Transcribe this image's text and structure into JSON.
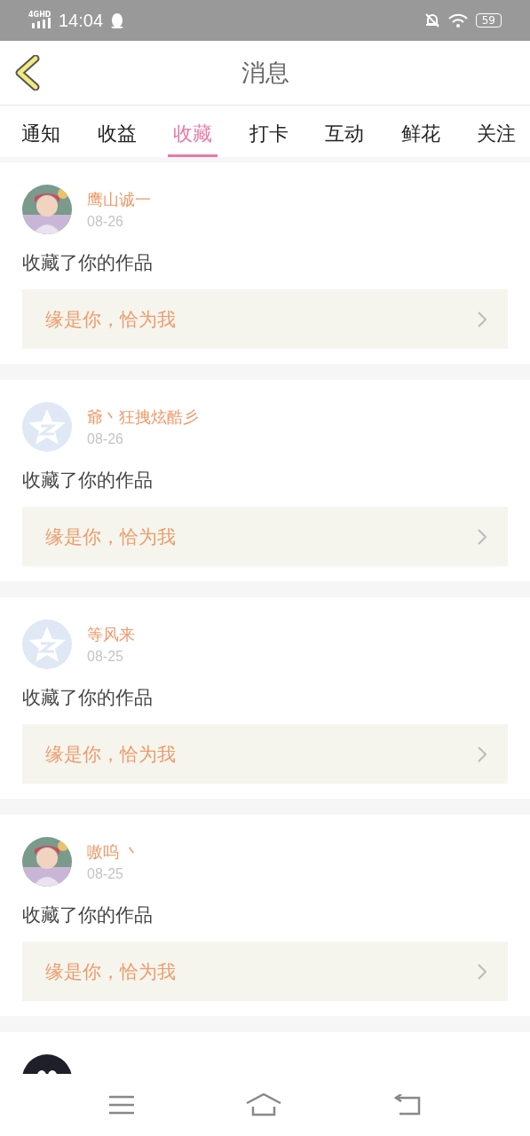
{
  "status_bar": {
    "network": "4GHD",
    "time": "14:04",
    "battery": "59"
  },
  "header": {
    "title": "消息"
  },
  "tabs": [
    {
      "label": "通知",
      "selected": false
    },
    {
      "label": "收益",
      "selected": false
    },
    {
      "label": "收藏",
      "selected": true
    },
    {
      "label": "打卡",
      "selected": false
    },
    {
      "label": "互动",
      "selected": false
    },
    {
      "label": "鲜花",
      "selected": false
    },
    {
      "label": "关注",
      "selected": false
    }
  ],
  "messages": [
    {
      "name": "鹰山诚一",
      "date": "08-26",
      "text": "收藏了你的作品",
      "work": "缘是你，恰为我"
    },
    {
      "avatar": {
        "kind": "default"
      },
      "name": "爺丶狂拽炫酷彡",
      "date": "08-26",
      "text": "收藏了你的作品",
      "work": "缘是你，恰为我"
    },
    {
      "avatar": {
        "kind": "default"
      },
      "name": "等风来",
      "date": "08-25",
      "text": "收藏了你的作品",
      "work": "缘是你，恰为我"
    },
    {
      "name": "嗷呜 丶",
      "date": "08-25",
      "text": "收藏了你的作品",
      "work": "缘是你，恰为我"
    },
    {
      "avatar": {
        "kind": "penguin"
      }
    }
  ]
}
